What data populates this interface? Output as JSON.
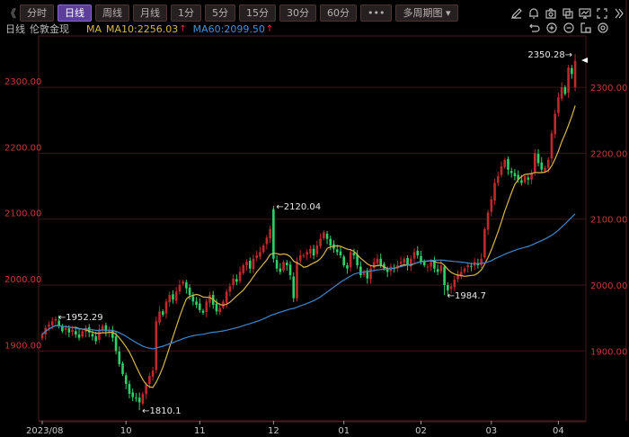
{
  "toolbar": {
    "collapse": "《",
    "buttons": [
      {
        "label": "分时",
        "active": false
      },
      {
        "label": "日线",
        "active": true
      },
      {
        "label": "周线",
        "active": false
      },
      {
        "label": "月线",
        "active": false
      },
      {
        "label": "1分",
        "active": false
      },
      {
        "label": "5分",
        "active": false
      },
      {
        "label": "15分",
        "active": false
      },
      {
        "label": "30分",
        "active": false
      },
      {
        "label": "60分",
        "active": false
      },
      {
        "label": "•••",
        "active": false
      },
      {
        "label": "多周期图 ▾",
        "active": false
      }
    ],
    "icons_row1": [
      "pencil-icon",
      "bell-icon",
      "camera-icon",
      "copy-icon",
      "monitor-icon",
      "fullscreen-icon",
      "expand-right-icon"
    ],
    "icons_row2": [
      "undo-icon",
      "zoom-in-icon",
      "zoom-out-icon",
      "window-icon",
      "settings-icon"
    ]
  },
  "legend": {
    "period": "日线",
    "instrument": "伦敦金现",
    "ma_label": "MA",
    "ma10": "MA10:2256.03",
    "ma60": "MA60:2099.50",
    "arrow": "↑"
  },
  "colors": {
    "up": "#c0282e",
    "down": "#2ed06a",
    "ma10": "#d8b64a",
    "ma60": "#3f86c8",
    "grid": "#3d1517",
    "axis_text": "#c8383a"
  },
  "chart_data": {
    "type": "candlestick",
    "title": "日线 伦敦金现",
    "y_ticks": [
      1900,
      2000,
      2100,
      2200,
      2300
    ],
    "y_tick_labels": [
      "1900.00",
      "2000.00",
      "2100.00",
      "2200.00",
      "2300.00"
    ],
    "ylim": [
      1790,
      2390
    ],
    "x_ticks": [
      {
        "label": "2023/08",
        "index": 0
      },
      {
        "label": "10",
        "index": 25
      },
      {
        "label": "11",
        "index": 47
      },
      {
        "label": "12",
        "index": 69
      },
      {
        "label": "01",
        "index": 90
      },
      {
        "label": "02",
        "index": 113
      },
      {
        "label": "03",
        "index": 134
      },
      {
        "label": "04",
        "index": 154
      }
    ],
    "close": [
      1925,
      1935,
      1940,
      1945,
      1948,
      1938,
      1930,
      1935,
      1928,
      1932,
      1925,
      1920,
      1930,
      1935,
      1928,
      1922,
      1915,
      1932,
      1938,
      1930,
      1932,
      1920,
      1900,
      1880,
      1865,
      1850,
      1835,
      1830,
      1828,
      1822,
      1835,
      1848,
      1862,
      1870,
      1945,
      1960,
      1955,
      1975,
      1985,
      1978,
      1990,
      2000,
      2005,
      1995,
      1985,
      1975,
      1970,
      1962,
      1958,
      1975,
      1985,
      1970,
      1960,
      1965,
      1975,
      1990,
      1998,
      2010,
      2005,
      2020,
      2030,
      2035,
      2025,
      2040,
      2045,
      2050,
      2060,
      2072,
      2085,
      2040,
      2025,
      2020,
      2035,
      2030,
      2015,
      1980,
      2035,
      2045,
      2045,
      2050,
      2055,
      2045,
      2060,
      2070,
      2080,
      2070,
      2060,
      2055,
      2050,
      2045,
      2030,
      2025,
      2050,
      2045,
      2030,
      2015,
      2020,
      2010,
      2025,
      2035,
      2040,
      2030,
      2025,
      2020,
      2028,
      2025,
      2030,
      2035,
      2040,
      2030,
      2040,
      2050,
      2045,
      2035,
      2030,
      2028,
      2035,
      2025,
      2020,
      2030,
      2000,
      1992,
      1998,
      2008,
      2015,
      2020,
      2025,
      2030,
      2028,
      2035,
      2030,
      2040,
      2085,
      2110,
      2130,
      2155,
      2165,
      2180,
      2190,
      2175,
      2170,
      2165,
      2160,
      2155,
      2165,
      2160,
      2170,
      2200,
      2185,
      2175,
      2178,
      2190,
      2230,
      2260,
      2285,
      2300,
      2290,
      2330,
      2320,
      2340
    ],
    "overrides": [
      {
        "index": 4,
        "high": 1952.29
      },
      {
        "index": 29,
        "low": 1810.1
      },
      {
        "index": 69,
        "open": 2115,
        "high": 2120.04
      },
      {
        "index": 120,
        "low": 1984.7
      },
      {
        "index": 159,
        "open": 2300,
        "high": 2350.28
      }
    ],
    "annotations": [
      {
        "index": 4,
        "value": 1952.29,
        "text": "←1952.29",
        "side": "right"
      },
      {
        "index": 29,
        "value": 1810.1,
        "text": "←1810.1",
        "side": "right"
      },
      {
        "index": 69,
        "value": 2120.04,
        "text": "←2120.04",
        "side": "right"
      },
      {
        "index": 120,
        "value": 1984.7,
        "text": "←1984.7",
        "side": "right"
      },
      {
        "index": 159,
        "value": 2350.28,
        "text": "2350.28→",
        "side": "left"
      }
    ],
    "series": [
      {
        "name": "MA10",
        "period": 10,
        "last": 2256.03
      },
      {
        "name": "MA60",
        "period": 60,
        "last": 2099.5
      }
    ]
  }
}
